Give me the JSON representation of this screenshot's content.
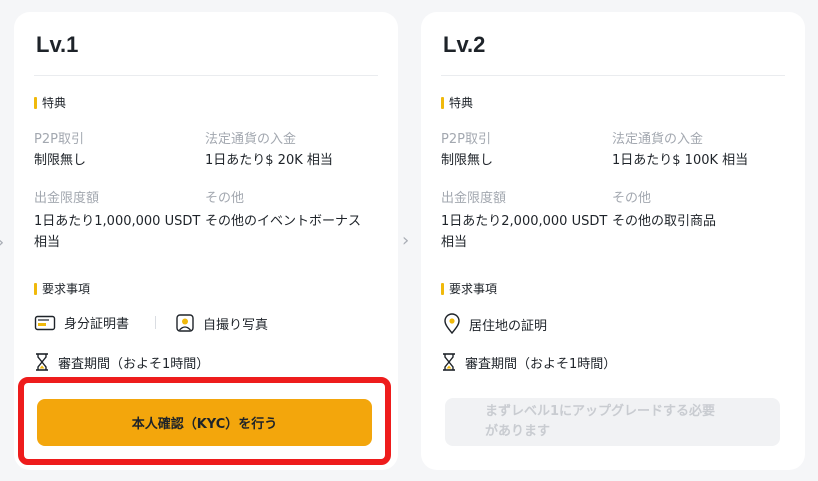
{
  "level1": {
    "title": "Lv.1",
    "benefits_header": "特典",
    "p2p_label": "P2P取引",
    "p2p_value": "制限無し",
    "fiat_label": "法定通貨の入金",
    "fiat_value": "1日あたり$ 20K 相当",
    "withdraw_label": "出金限度額",
    "withdraw_value_line1": "1日あたり1,000,000 USDT",
    "withdraw_value_line2": "相当",
    "other_label": "その他",
    "other_value": "その他のイベントボーナス",
    "requirements_header": "要求事項",
    "req_id": "身分証明書",
    "req_selfie": "自撮り写真",
    "review": "審査期間（およそ1時間）",
    "cta": "本人確認（KYC）を行う"
  },
  "level2": {
    "title": "Lv.2",
    "benefits_header": "特典",
    "p2p_label": "P2P取引",
    "p2p_value": "制限無し",
    "fiat_label": "法定通貨の入金",
    "fiat_value": "1日あたり$ 100K 相当",
    "withdraw_label": "出金限度額",
    "withdraw_value_line1": "1日あたり2,000,000 USDT",
    "withdraw_value_line2": "相当",
    "other_label": "その他",
    "other_value": "その他の取引商品",
    "requirements_header": "要求事項",
    "req_address": "居住地の証明",
    "review": "審査期間（およそ1時間）",
    "cta_line1": "まずレベル1にアップグレードする必要",
    "cta_line2": "があります"
  },
  "icons": [
    "id-card-icon",
    "selfie-icon",
    "hourglass-icon",
    "location-pin-icon",
    "chevron-right-icon"
  ],
  "colors": {
    "accent": "#f3a60c",
    "highlight": "#ee1c1c"
  }
}
